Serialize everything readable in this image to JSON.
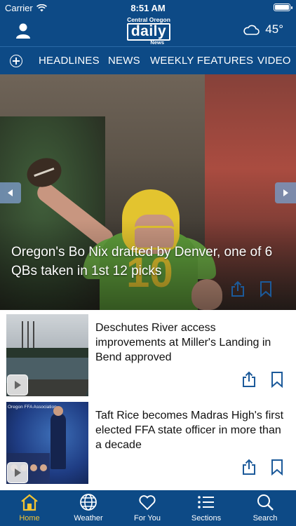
{
  "status_bar": {
    "carrier": "Carrier",
    "time": "8:51 AM"
  },
  "header": {
    "logo": {
      "top": "Central Oregon",
      "word": "daily",
      "bottom": "News"
    },
    "weather": {
      "temperature": "45°",
      "icon": "cloud-icon"
    }
  },
  "nav": {
    "tabs": [
      {
        "label": "HEADLINES"
      },
      {
        "label": "NEWS"
      },
      {
        "label": "WEEKLY FEATURES"
      },
      {
        "label": "VIDEO"
      }
    ]
  },
  "hero": {
    "headline": "Oregon's Bo Nix drafted by Denver, one of 6 QBs taken in 1st 12 picks"
  },
  "stories": [
    {
      "headline": "Deschutes River access improvements at Miller's Landing in Bend approved"
    },
    {
      "headline": "Taft Rice becomes Madras High's first elected FFA state officer in more than a decade",
      "thumb_caption": "Oregon FFA Association"
    }
  ],
  "tab_bar": {
    "items": [
      {
        "label": "Home",
        "icon": "home-icon",
        "active": true
      },
      {
        "label": "Weather",
        "icon": "globe-icon",
        "active": false
      },
      {
        "label": "For You",
        "icon": "heart-icon",
        "active": false
      },
      {
        "label": "Sections",
        "icon": "list-icon",
        "active": false
      },
      {
        "label": "Search",
        "icon": "search-icon",
        "active": false
      }
    ]
  },
  "colors": {
    "brand_blue": "#0d4a86",
    "active_tab": "#f4c431",
    "accent_icon": "#1c5a9a"
  }
}
